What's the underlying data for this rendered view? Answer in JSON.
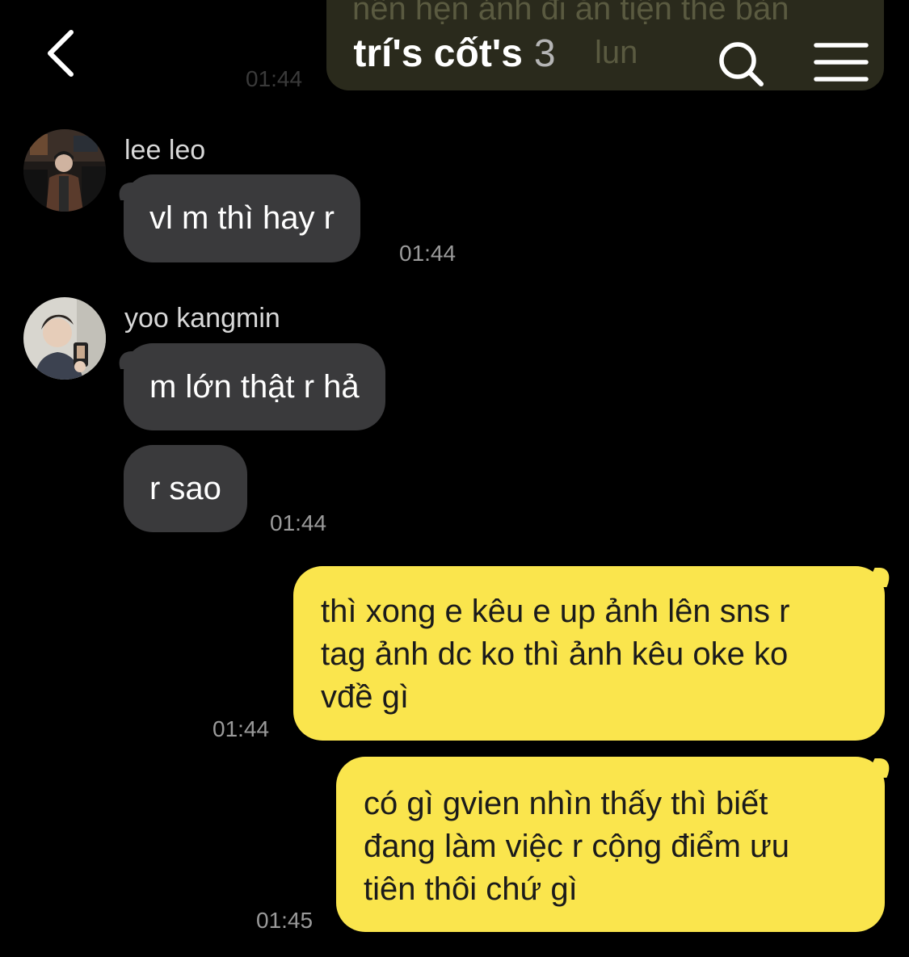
{
  "header": {
    "back_icon": "chevron-left-icon",
    "title": "trí's cốt's",
    "member_count": "3",
    "search_icon": "search-icon",
    "menu_icon": "hamburger-menu-icon"
  },
  "colors": {
    "background": "#000000",
    "incoming_bubble": "#3a3a3c",
    "outgoing_bubble": "#fae54d",
    "timestamp": "#9a9a9a"
  },
  "previous_message": {
    "text": "nên hẹn ảnh đi ăn tiện thể bàn",
    "partial_line": "lun",
    "time": "01:44"
  },
  "messages": [
    {
      "sender": "lee leo",
      "avatar_icon": "user-avatar-photo",
      "bubbles": [
        "vl m thì hay r"
      ],
      "time": "01:44"
    },
    {
      "sender": "yoo kangmin",
      "avatar_icon": "user-avatar-photo",
      "bubbles": [
        "m lớn thật r hả",
        "r sao"
      ],
      "time": "01:44"
    },
    {
      "sender": "me",
      "lines": [
        "thì xong e kêu e up ảnh lên sns r",
        "tag ảnh dc ko thì ảnh kêu oke ko",
        "vđề gì"
      ],
      "time": "01:44"
    },
    {
      "sender": "me",
      "lines": [
        "có gì gvien nhìn thấy thì biết",
        "đang làm việc r cộng điểm ưu",
        "tiên thôi chứ gì"
      ],
      "time": "01:45"
    }
  ]
}
